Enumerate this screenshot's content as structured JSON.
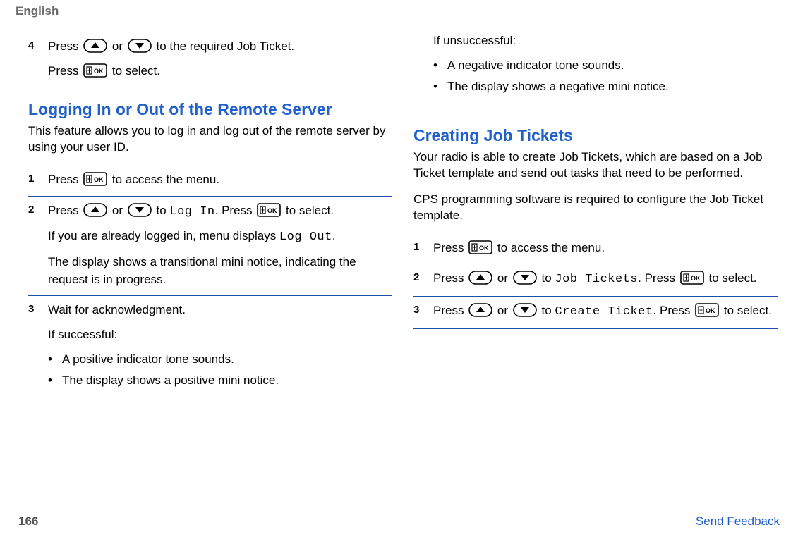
{
  "header": {
    "language": "English"
  },
  "col1": {
    "step4": {
      "num": "4",
      "line1_a": "Press ",
      "line1_b": " or ",
      "line1_c": " to the required Job Ticket.",
      "line2_a": "Press ",
      "line2_b": " to select."
    },
    "section1": {
      "heading": "Logging In or Out of the Remote Server",
      "intro": "This feature allows you to log in and log out of the remote server by using your user ID."
    },
    "s1step1": {
      "num": "1",
      "a": "Press ",
      "b": " to access the menu."
    },
    "s1step2": {
      "num": "2",
      "a": "Press ",
      "b": " or ",
      "c": " to ",
      "code": "Log In",
      "d": ". Press ",
      "e": " to select.",
      "p2a": "If you are already logged in, menu displays ",
      "p2code": "Log Out",
      "p2b": ".",
      "p3": "The display shows a transitional mini notice, indicating the request is in progress."
    },
    "s1step3": {
      "num": "3",
      "line1": "Wait for acknowledgment.",
      "line2": "If successful:",
      "bullet1": "A positive indicator tone sounds.",
      "bullet2": "The display shows a positive mini notice."
    }
  },
  "col2": {
    "unsucc": {
      "label": "If unsuccessful:",
      "bullet1": "A negative indicator tone sounds.",
      "bullet2": "The display shows a negative mini notice."
    },
    "section2": {
      "heading": "Creating Job Tickets",
      "intro1": "Your radio is able to create Job Tickets, which are based on a Job Ticket template and send out tasks that need to be performed.",
      "intro2": "CPS programming software is required to configure the Job Ticket template."
    },
    "s2step1": {
      "num": "1",
      "a": "Press ",
      "b": " to access the menu."
    },
    "s2step2": {
      "num": "2",
      "a": "Press ",
      "b": " or ",
      "c": " to ",
      "code": "Job Tickets",
      "d": ". Press ",
      "e": " to select."
    },
    "s2step3": {
      "num": "3",
      "a": "Press ",
      "b": " or ",
      "c": " to ",
      "code": "Create Ticket",
      "d": ". Press ",
      "e": " to select."
    }
  },
  "footer": {
    "page": "166",
    "feedback": "Send Feedback"
  },
  "bullet_dot": "•"
}
